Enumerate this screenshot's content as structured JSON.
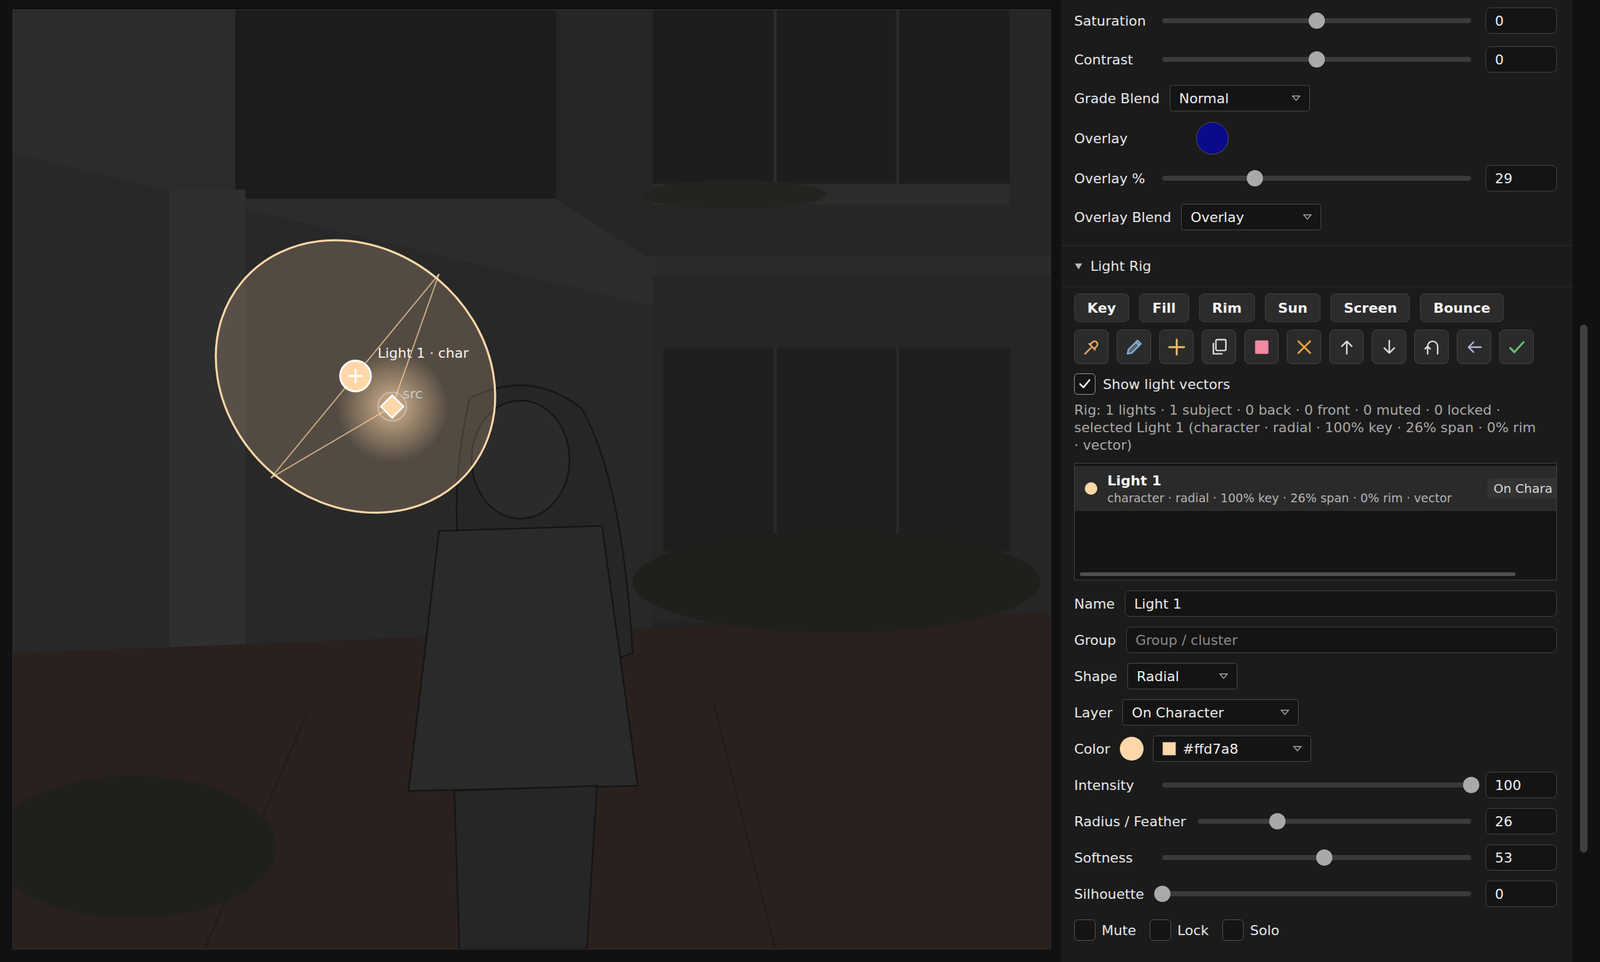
{
  "canvas": {
    "light_label": "Light 1 · char",
    "source_label": "src"
  },
  "grade": [
    {
      "kind": "slider",
      "label": "Saturation",
      "level": 0.5,
      "value": "0"
    },
    {
      "kind": "slider",
      "label": "Contrast",
      "level": 0.5,
      "value": "0"
    },
    {
      "kind": "select",
      "label": "Grade Blend",
      "value": "Normal"
    },
    {
      "kind": "swatch",
      "label": "Overlay",
      "swatch": "#0a0a8a"
    },
    {
      "kind": "slider",
      "label": "Overlay %",
      "level": 0.3,
      "value": "29"
    },
    {
      "kind": "select",
      "label": "Overlay Blend",
      "value": "Overlay"
    }
  ],
  "light_rig": {
    "title": "Light Rig",
    "expanded": true,
    "presets": [
      "Key",
      "Fill",
      "Rim",
      "Sun",
      "Screen",
      "Bounce"
    ],
    "show_vectors": {
      "label": "Show light vectors",
      "checked": true
    },
    "summary": "Rig: 1 lights · 1 subject · 0 back · 0 front · 0 muted · 0 locked · selected Light 1 (character · radial · 100% key · 26% span · 0% rim · vector)",
    "lights": [
      {
        "name": "Light 1",
        "detail": "character · radial · 100% key · 26% span · 0% rim · vector",
        "badge": "On Chara",
        "color": "#ffd7a8",
        "selected": true
      }
    ],
    "properties": [
      {
        "kind": "text",
        "label": "Name",
        "value": "Light 1",
        "placeholder": ""
      },
      {
        "kind": "text",
        "label": "Group",
        "value": "",
        "placeholder": "Group / cluster"
      },
      {
        "kind": "select",
        "label": "Shape",
        "value": "Radial"
      },
      {
        "kind": "select",
        "label": "Layer",
        "value": "On Character"
      },
      {
        "kind": "color",
        "label": "Color",
        "value": "#ffd7a8",
        "swatch": "#ffd7a8"
      },
      {
        "kind": "slider",
        "label": "Intensity",
        "level": 1.0,
        "value": "100"
      },
      {
        "kind": "slider",
        "label": "Radius / Feather",
        "level": 0.29,
        "value": "26"
      },
      {
        "kind": "slider",
        "label": "Softness",
        "level": 0.525,
        "value": "53"
      },
      {
        "kind": "slider",
        "label": "Silhouette",
        "level": 0.0,
        "value": "0"
      }
    ],
    "toggles": [
      {
        "label": "Mute",
        "checked": false
      },
      {
        "label": "Lock",
        "checked": false
      },
      {
        "label": "Solo",
        "checked": false
      }
    ]
  }
}
